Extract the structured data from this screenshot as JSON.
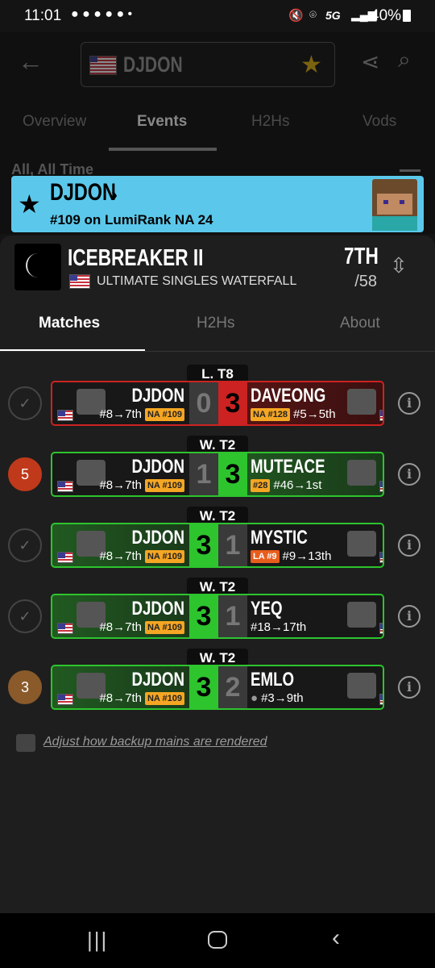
{
  "status_bar": {
    "time": "11:01",
    "network": "5G",
    "battery": "40%"
  },
  "header": {
    "player_name": "DJDON"
  },
  "top_tabs": [
    "Overview",
    "Events",
    "H2Hs",
    "Vods"
  ],
  "filter_text": "All, All Time",
  "banner": {
    "name": "DJDON",
    "rank_text": "#109 on LumiRank NA 24"
  },
  "event": {
    "title": "ICEBREAKER II",
    "subtitle": "ULTIMATE SINGLES WATERFALL",
    "placement": "7TH",
    "entrants": "/58"
  },
  "sheet_tabs": [
    "Matches",
    "H2Hs",
    "About"
  ],
  "matches": [
    {
      "round": "L. T8",
      "left_name": "DJDON",
      "left_seed": "#8→7th",
      "left_badge": "NA #109",
      "left_score": "0",
      "right_score": "3",
      "right_name": "DAVEONG",
      "right_badge": "NA #128",
      "right_seed": "#5→5th",
      "indicator": "✓",
      "result": "loss"
    },
    {
      "round": "W. T2",
      "left_name": "DJDON",
      "left_seed": "#8→7th",
      "left_badge": "NA #109",
      "left_score": "1",
      "right_score": "3",
      "right_name": "MUTEACE",
      "right_badge": "#28",
      "right_seed": "#46→1st",
      "indicator": "5",
      "result": "loss-green"
    },
    {
      "round": "W. T2",
      "left_name": "DJDON",
      "left_seed": "#8→7th",
      "left_badge": "NA #109",
      "left_score": "3",
      "right_score": "1",
      "right_name": "MYSTIC",
      "right_badge": "LA #9",
      "right_seed": "#9→13th",
      "indicator": "✓",
      "result": "win"
    },
    {
      "round": "W. T2",
      "left_name": "DJDON",
      "left_seed": "#8→7th",
      "left_badge": "NA #109",
      "left_score": "3",
      "right_score": "1",
      "right_name": "YEQ",
      "right_badge": "",
      "right_seed": "#18→17th",
      "indicator": "✓",
      "result": "win"
    },
    {
      "round": "W. T2",
      "left_name": "DJDON",
      "left_seed": "#8→7th",
      "left_badge": "NA #109",
      "left_score": "3",
      "right_score": "2",
      "right_name": "EMLO",
      "right_badge": "",
      "right_seed": "#3→9th",
      "indicator": "3",
      "result": "win"
    }
  ],
  "footer_link": "Adjust how backup mains are rendered",
  "colors": {
    "win": "#2ec42e",
    "loss": "#cc2222",
    "banner": "#5bc8eb",
    "badge": "#f5a623"
  }
}
